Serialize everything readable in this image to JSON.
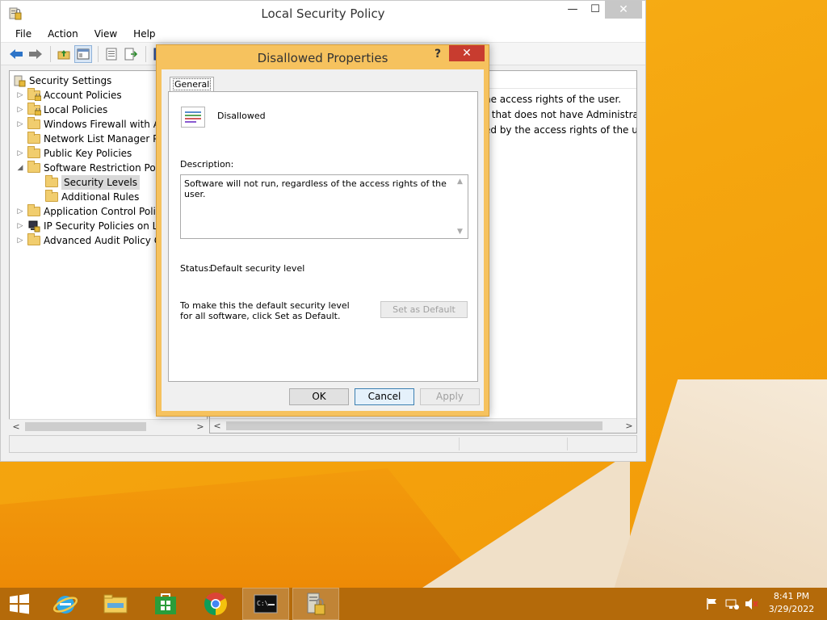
{
  "mmc": {
    "title": "Local Security Policy",
    "minimize_glyph": "—",
    "maximize_glyph": "☐",
    "close_glyph": "✕",
    "menu": [
      "File",
      "Action",
      "View",
      "Help"
    ],
    "tree": [
      {
        "label": "Security Settings",
        "indent": 0,
        "expander": "",
        "icon": "shield-icon"
      },
      {
        "label": "Account Policies",
        "indent": 1,
        "expander": "▷",
        "icon": "folder-lock-icon"
      },
      {
        "label": "Local Policies",
        "indent": 1,
        "expander": "▷",
        "icon": "folder-lock-icon"
      },
      {
        "label": "Windows Firewall with Ad",
        "indent": 1,
        "expander": "▷",
        "icon": "folder-icon"
      },
      {
        "label": "Network List Manager Pol",
        "indent": 1,
        "expander": "",
        "icon": "folder-icon"
      },
      {
        "label": "Public Key Policies",
        "indent": 1,
        "expander": "▷",
        "icon": "folder-icon"
      },
      {
        "label": "Software Restriction Polici",
        "indent": 1,
        "expander": "◢",
        "icon": "folder-icon"
      },
      {
        "label": "Security Levels",
        "indent": 2,
        "expander": "",
        "icon": "folder-icon",
        "selected": true
      },
      {
        "label": "Additional Rules",
        "indent": 2,
        "expander": "",
        "icon": "folder-icon"
      },
      {
        "label": "Application Control Polici",
        "indent": 1,
        "expander": "▷",
        "icon": "folder-icon"
      },
      {
        "label": "IP Security Policies on Loc",
        "indent": 1,
        "expander": "▷",
        "icon": "network-policy-icon"
      },
      {
        "label": "Advanced Audit Policy Co",
        "indent": 1,
        "expander": "▷",
        "icon": "folder-icon"
      }
    ],
    "right_rows": [
      "he access rights of the user.",
      "r that does not have Administrator",
      "ed by the access rights of the user."
    ],
    "scroll_left_glyph": "<",
    "scroll_right_glyph": ">"
  },
  "dialog": {
    "title": "Disallowed Properties",
    "help_glyph": "?",
    "close_glyph": "✕",
    "tab": "General",
    "level_name": "Disallowed",
    "description_label": "Description:",
    "description_text": "Software will not run, regardless of the access rights of the user.",
    "status_label": "Status:",
    "status_value": "Default security level",
    "default_note": "To make this the default security level for all software, click Set as Default.",
    "set_default_label": "Set as Default",
    "ok_label": "OK",
    "cancel_label": "Cancel",
    "apply_label": "Apply"
  },
  "taskbar": {
    "time": "8:41 PM",
    "date": "3/29/2022"
  }
}
